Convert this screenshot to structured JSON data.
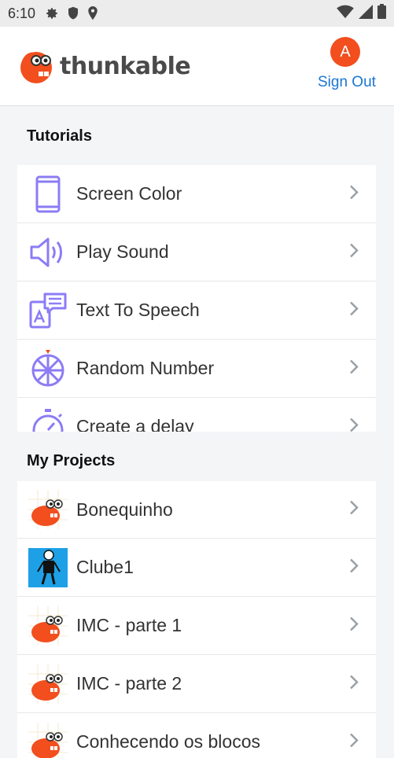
{
  "status_bar": {
    "time": "6:10",
    "icons": [
      "gear-icon",
      "shield-icon",
      "location-icon"
    ],
    "right_icons": [
      "wifi-icon",
      "signal-icon",
      "battery-icon"
    ]
  },
  "header": {
    "brand": "thunkable",
    "avatar_initial": "A",
    "avatar_color": "#f24e1e",
    "sign_out": "Sign Out"
  },
  "tutorials": {
    "title": "Tutorials",
    "items": [
      {
        "label": "Screen Color",
        "icon": "phone-icon"
      },
      {
        "label": "Play Sound",
        "icon": "speaker-icon"
      },
      {
        "label": "Text To Speech",
        "icon": "text-to-speech-icon"
      },
      {
        "label": "Random Number",
        "icon": "wheel-icon"
      },
      {
        "label": "Create a delay",
        "icon": "stopwatch-icon"
      }
    ]
  },
  "projects": {
    "title": "My Projects",
    "items": [
      {
        "label": "Bonequinho",
        "thumb": "mascot"
      },
      {
        "label": "Clube1",
        "thumb": "figure"
      },
      {
        "label": "IMC - parte 1",
        "thumb": "mascot"
      },
      {
        "label": "IMC - parte 2",
        "thumb": "mascot"
      },
      {
        "label": "Conhecendo os blocos",
        "thumb": "mascot"
      }
    ]
  },
  "colors": {
    "accent": "#1976d2",
    "icon_purple": "#8b7cf6",
    "brand_red": "#f24e1e"
  }
}
